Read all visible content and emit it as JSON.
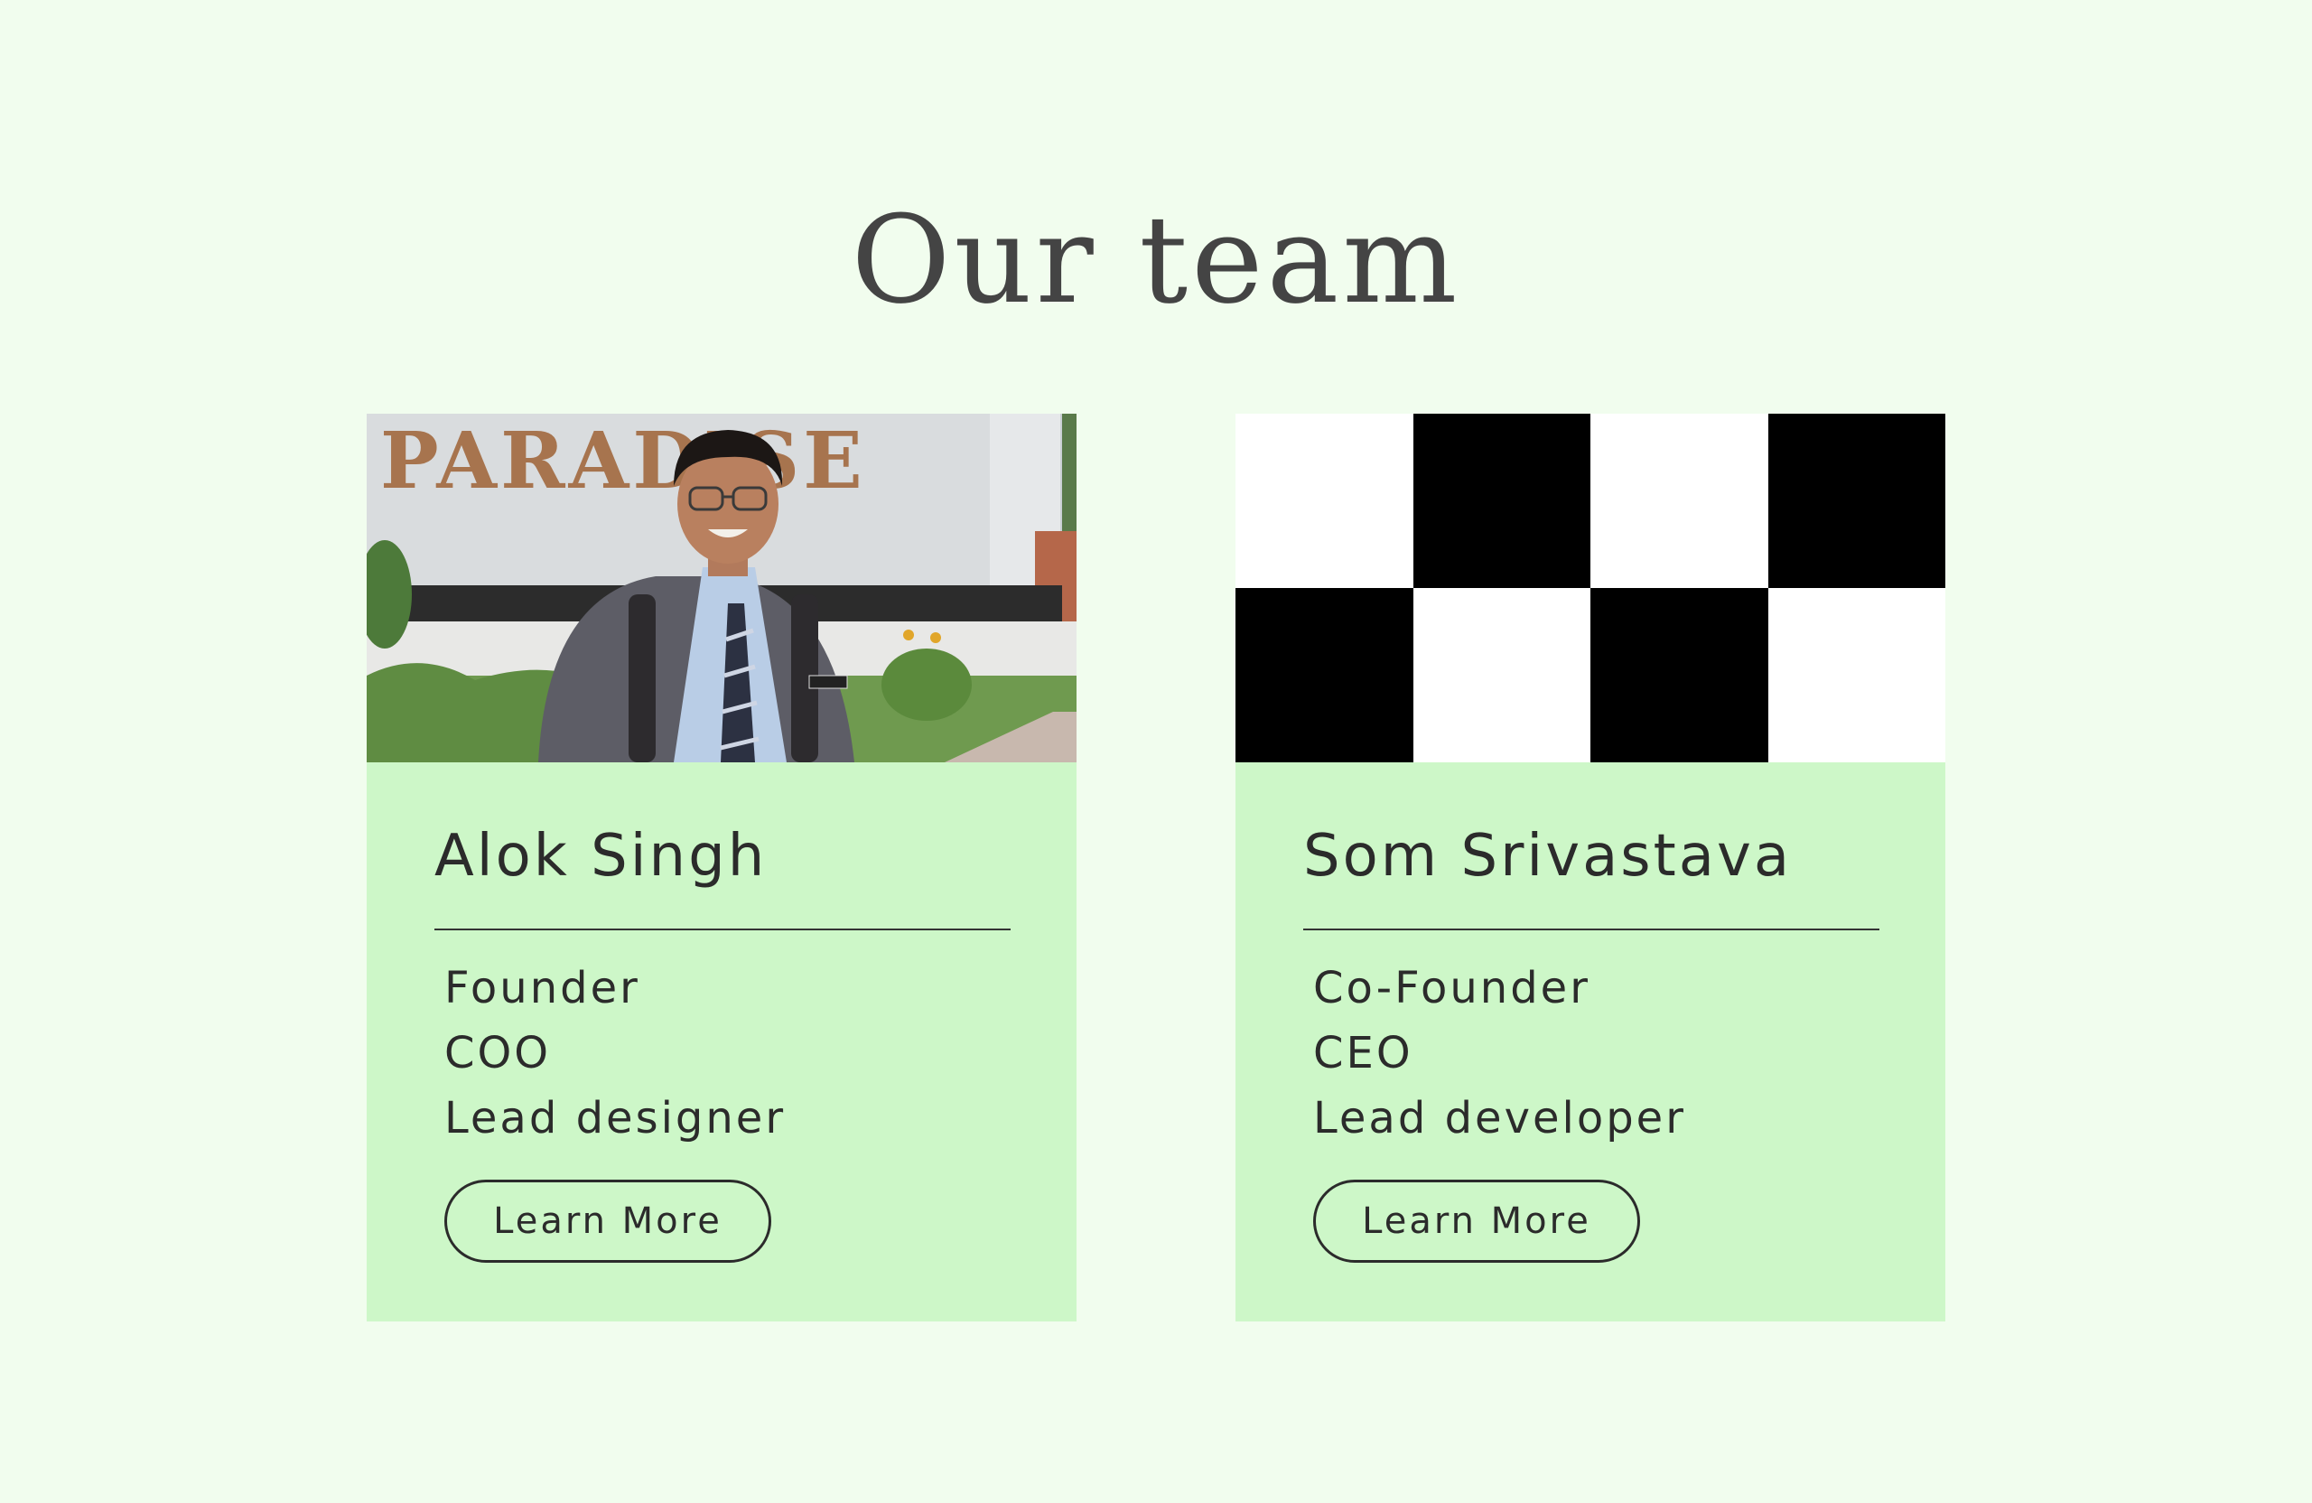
{
  "page": {
    "title": "Our team",
    "background": "#f1fdee",
    "card_color": "#cdf7c8"
  },
  "members": [
    {
      "name": "Alok Singh",
      "photo_sign_text": "PARADISE",
      "roles": [
        "Founder",
        "COO",
        "Lead designer"
      ],
      "button_label": "Learn More"
    },
    {
      "name": "Som Srivastava",
      "image": "checkerboard-placeholder",
      "roles": [
        "Co-Founder",
        "CEO",
        "Lead developer"
      ],
      "button_label": "Learn More"
    }
  ]
}
